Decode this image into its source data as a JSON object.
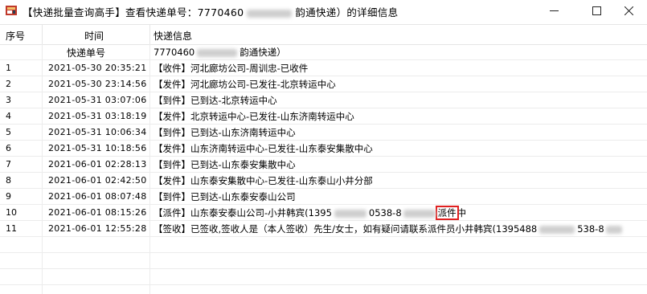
{
  "window": {
    "title_prefix": "【快递批量查询高手】查看快递单号：7770460",
    "title_suffix": "韵通快递）的详细信息",
    "buttons": {
      "minimize": "─",
      "maximize": "☐",
      "close": "✕"
    }
  },
  "table": {
    "headers": {
      "index": "序号",
      "time": "时间",
      "info": "快递信息",
      "waybill_label": "快递单号",
      "waybill_value_prefix": "7770460",
      "waybill_value_suffix": "韵通快递）"
    },
    "rows": [
      {
        "idx": "1",
        "time": "2021-05-30 20:35:21",
        "info": "【收件】河北廊坊公司-周训忠-已收件"
      },
      {
        "idx": "2",
        "time": "2021-05-30 23:14:56",
        "info": "【发件】河北廊坊公司-已发往-北京转运中心"
      },
      {
        "idx": "3",
        "time": "2021-05-31 03:07:06",
        "info": "【到件】已到达-北京转运中心"
      },
      {
        "idx": "4",
        "time": "2021-05-31 03:18:19",
        "info": "【发件】北京转运中心-已发往-山东济南转运中心"
      },
      {
        "idx": "5",
        "time": "2021-05-31 10:06:34",
        "info": "【到件】已到达-山东济南转运中心"
      },
      {
        "idx": "6",
        "time": "2021-05-31 10:18:56",
        "info": "【发件】山东济南转运中心-已发往-山东泰安集散中心"
      },
      {
        "idx": "7",
        "time": "2021-06-01 02:28:13",
        "info": "【到件】已到达-山东泰安集散中心"
      },
      {
        "idx": "8",
        "time": "2021-06-01 02:42:50",
        "info": "【发件】山东泰安集散中心-已发往-山东泰山小井分部"
      },
      {
        "idx": "9",
        "time": "2021-06-01 08:07:48",
        "info": "【到件】已到达-山东泰安泰山公司"
      },
      {
        "idx": "10",
        "time": "2021-06-01 08:15:26",
        "info_prefix": "【派件】山东泰安泰山公司-小井韩宾(1395",
        "info_mid": "0538-8",
        "info_highlight": "派件",
        "info_suffix": "中"
      },
      {
        "idx": "11",
        "time": "2021-06-01 12:55:28",
        "info_prefix": "【签收】已签收,签收人是（本人签收）先生/女士，如有疑问请联系派件员小井韩宾(1395488",
        "info_mid": "538-8"
      }
    ]
  },
  "colors": {
    "highlight_border": "#e02020",
    "grid": "#ececec"
  }
}
